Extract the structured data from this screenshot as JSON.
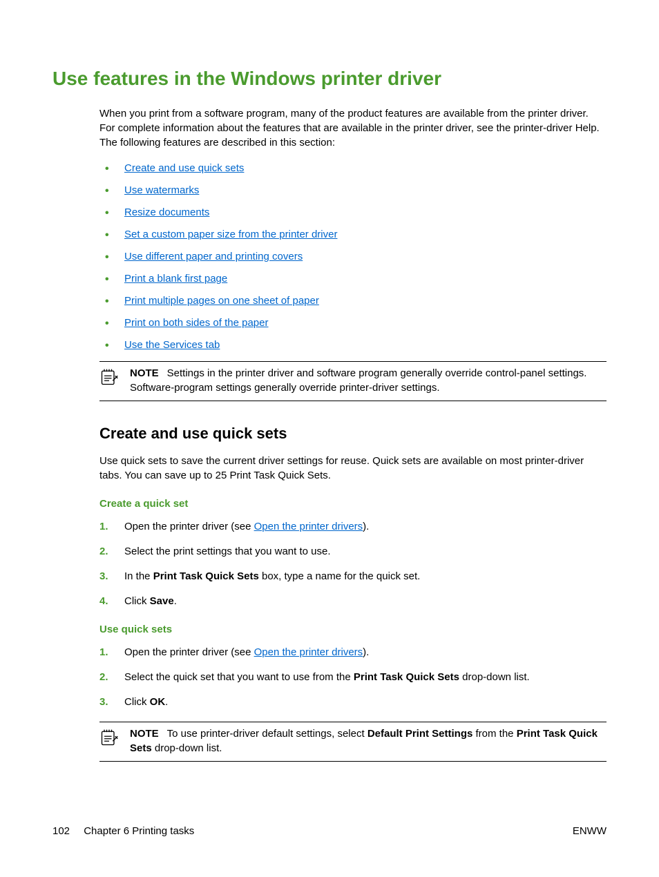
{
  "title": "Use features in the Windows printer driver",
  "intro": "When you print from a software program, many of the product features are available from the printer driver. For complete information about the features that are available in the printer driver, see the printer-driver Help. The following features are described in this section:",
  "links": [
    "Create and use quick sets",
    "Use watermarks",
    "Resize documents",
    "Set a custom paper size from the printer driver",
    "Use different paper and printing covers",
    "Print a blank first page",
    "Print multiple pages on one sheet of paper",
    "Print on both sides of the paper",
    "Use the Services tab"
  ],
  "note1": {
    "label": "NOTE",
    "text": "Settings in the printer driver and software program generally override control-panel settings. Software-program settings generally override printer-driver settings."
  },
  "section": {
    "heading": "Create and use quick sets",
    "body": "Use quick sets to save the current driver settings for reuse. Quick sets are available on most printer-driver tabs. You can save up to 25 Print Task Quick Sets."
  },
  "createHeading": "Create a quick set",
  "createSteps": {
    "s1a": "Open the printer driver (see ",
    "s1link": "Open the printer drivers",
    "s1b": ").",
    "s2": "Select the print settings that you want to use.",
    "s3a": "In the ",
    "s3bold": "Print Task Quick Sets",
    "s3b": " box, type a name for the quick set.",
    "s4a": "Click ",
    "s4bold": "Save",
    "s4b": "."
  },
  "useHeading": "Use quick sets",
  "useSteps": {
    "s1a": "Open the printer driver (see ",
    "s1link": "Open the printer drivers",
    "s1b": ").",
    "s2a": "Select the quick set that you want to use from the ",
    "s2bold": "Print Task Quick Sets",
    "s2b": " drop-down list.",
    "s3a": "Click ",
    "s3bold": "OK",
    "s3b": "."
  },
  "note2": {
    "label": "NOTE",
    "t1": "To use printer-driver default settings, select ",
    "b1": "Default Print Settings",
    "t2": " from the ",
    "b2": "Print Task Quick Sets",
    "t3": " drop-down list."
  },
  "footer": {
    "page": "102",
    "chapter": "Chapter 6   Printing tasks",
    "right": "ENWW"
  }
}
